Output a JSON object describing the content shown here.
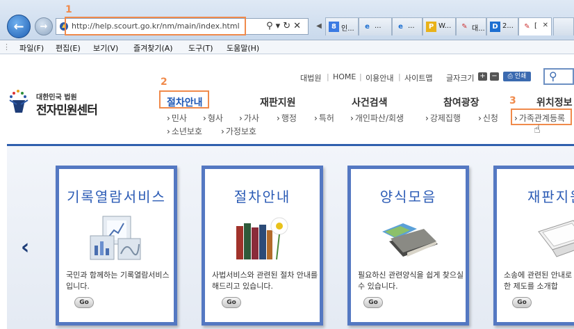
{
  "browser": {
    "url": "http://help.scourt.go.kr/nm/main/index.html",
    "tabs": [
      {
        "icon": "8",
        "label": "인..."
      },
      {
        "icon": "e",
        "label": "..."
      },
      {
        "icon": "e",
        "label": "..."
      },
      {
        "icon": "P",
        "label": "W..."
      },
      {
        "icon": "✎",
        "label": "대..."
      },
      {
        "icon": "D",
        "label": "2..."
      },
      {
        "icon": "✎",
        "label": "["
      }
    ],
    "menu": [
      "파일(F)",
      "편집(E)",
      "보기(V)",
      "즐겨찾기(A)",
      "도구(T)",
      "도움말(H)"
    ]
  },
  "annotations": [
    "1",
    "2",
    "3"
  ],
  "site": {
    "logo_small": "대한민국 법원",
    "logo_big": "전자민원센터",
    "util_links": [
      "대법원",
      "HOME",
      "이용안내",
      "사이트맵"
    ],
    "font_size_label": "글자크기",
    "print_label": "인쇄",
    "gnb": [
      "절차안내",
      "재판지원",
      "사건검색",
      "참여광장",
      "위치정보"
    ],
    "sub_menu": [
      "민사",
      "형사",
      "가사",
      "행정",
      "특허",
      "개인파산/회생",
      "강제집행",
      "신청",
      "가족관계등록",
      "소년보호",
      "가정보호"
    ]
  },
  "cards": [
    {
      "title": "기록열람서비스",
      "desc": "국민과 함께하는 기록열람서비스입니다.",
      "go": "Go"
    },
    {
      "title": "절차안내",
      "desc": "사법서비스와 관련된 절차 안내를 해드리고 있습니다.",
      "go": "Go"
    },
    {
      "title": "양식모음",
      "desc": "필요하신 관련양식을 쉽게 찾으실 수 있습니다.",
      "go": "Go"
    },
    {
      "title": "재판지원",
      "desc": "소송에 관련된 안내로 편리한 제도를 소개합",
      "go": "Go"
    }
  ],
  "colors": {
    "accent": "#2f5fae",
    "highlight": "#f08a4b",
    "card_border": "#5478c2"
  }
}
